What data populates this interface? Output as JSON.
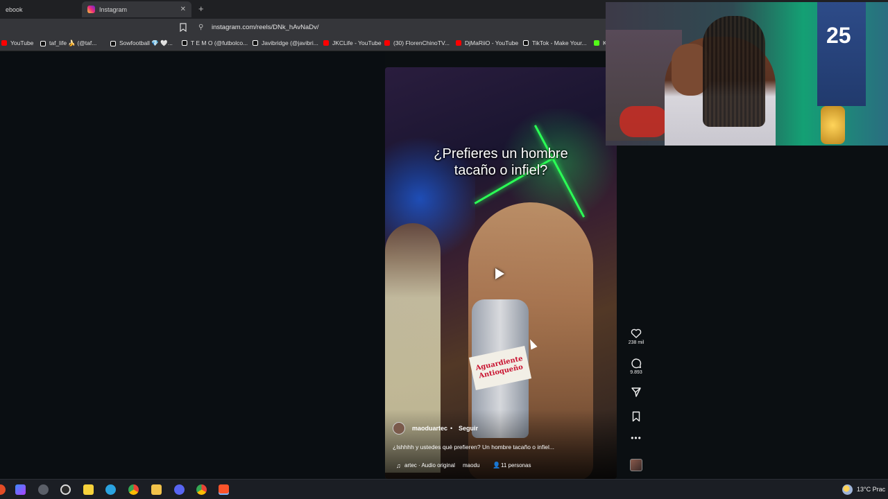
{
  "browser": {
    "tabs": [
      {
        "label": "ebook",
        "active": false
      },
      {
        "label": "Instagram",
        "active": true
      }
    ],
    "url": "instagram.com/reels/DNk_hAvNaDv/",
    "bookmarks": [
      {
        "label": "YouTube",
        "icon": "youtube-icon"
      },
      {
        "label": "taf_life 🍌 (@taf...",
        "icon": "tiktok-icon"
      },
      {
        "label": "Sowfootball 💎 🤍...",
        "icon": "tiktok-icon"
      },
      {
        "label": "T E M O (@futbolco...",
        "icon": "tiktok-icon"
      },
      {
        "label": "Javibridge (@javibri...",
        "icon": "tiktok-icon"
      },
      {
        "label": "JKCLife - YouTube",
        "icon": "youtube-icon"
      },
      {
        "label": "(30) FlorenChinoTV...",
        "icon": "youtube-icon"
      },
      {
        "label": "DjMaRiiO - YouTube",
        "icon": "youtube-icon"
      },
      {
        "label": "TikTok - Make Your...",
        "icon": "tiktok-icon"
      },
      {
        "label": "Ki",
        "icon": "kick-icon"
      }
    ]
  },
  "reel": {
    "caption_line1": "¿Prefieres un hombre",
    "caption_line2": "tacaño o infiel?",
    "bottle_line1": "Aguardiente",
    "bottle_line2": "Antioqueño",
    "username": "maoduartec",
    "separator": "•",
    "follow_label": "Seguir",
    "description": "¿Ishhhh y ustedes qué prefieren? Un hombre tacaño o infiel...",
    "audio_label": "artec · Audio original",
    "audio_label2": "maodu",
    "people_label": "11 personas"
  },
  "actions": {
    "likes": "238 mil",
    "comments": "9.893"
  },
  "webcam": {
    "jersey_number": "25"
  },
  "taskbar": {
    "weather": "13°C  Prac",
    "icons": [
      "windows-icon",
      "copilot-icon",
      "settings-icon",
      "obs-icon",
      "sticky-notes-icon",
      "telegram-icon",
      "chrome-icon",
      "file-explorer-icon",
      "discord-icon",
      "chrome-icon-2",
      "brave-icon"
    ]
  },
  "colors": {
    "accent_neon": "#2bff56",
    "instagram_gradient": [
      "#f9ce34",
      "#ee2a7b",
      "#6228d7"
    ],
    "youtube": "#ff0000"
  }
}
